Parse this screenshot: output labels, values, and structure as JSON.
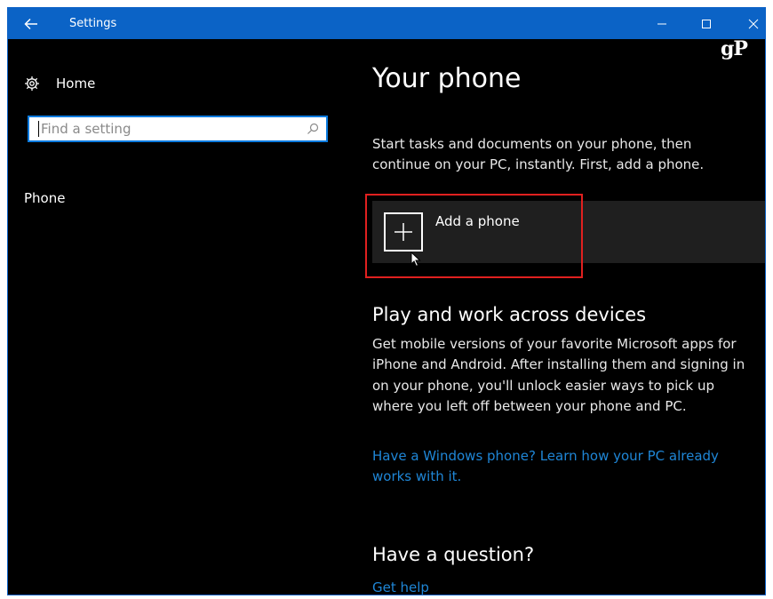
{
  "window": {
    "title": "Settings",
    "watermark": "gP"
  },
  "sidebar": {
    "home_label": "Home",
    "search_placeholder": "Find a setting",
    "nav_items": [
      "Phone"
    ]
  },
  "main": {
    "title": "Your phone",
    "intro": "Start tasks and documents on your phone, then continue on your PC, instantly. First, add a phone.",
    "add_phone_label": "Add a phone",
    "play_heading": "Play and work across devices",
    "play_body": "Get mobile versions of your favorite Microsoft apps for iPhone and Android. After installing them and signing in on your phone, you'll unlock easier ways to pick up where you left off between your phone and PC.",
    "windows_link": "Have a Windows phone? Learn how your PC already works with it.",
    "question_heading": "Have a question?",
    "help_link": "Get help"
  },
  "colors": {
    "titlebar": "#0b63c6",
    "background": "#000000",
    "card": "#1f1f1f",
    "link": "#1f86d6",
    "highlight": "#e0201f"
  },
  "icons": {
    "back": "back-arrow-icon",
    "minimize": "minimize-icon",
    "maximize": "maximize-icon",
    "close": "close-icon",
    "home": "gear-icon",
    "search": "search-icon",
    "add": "plus-icon",
    "cursor": "mouse-cursor-icon"
  }
}
